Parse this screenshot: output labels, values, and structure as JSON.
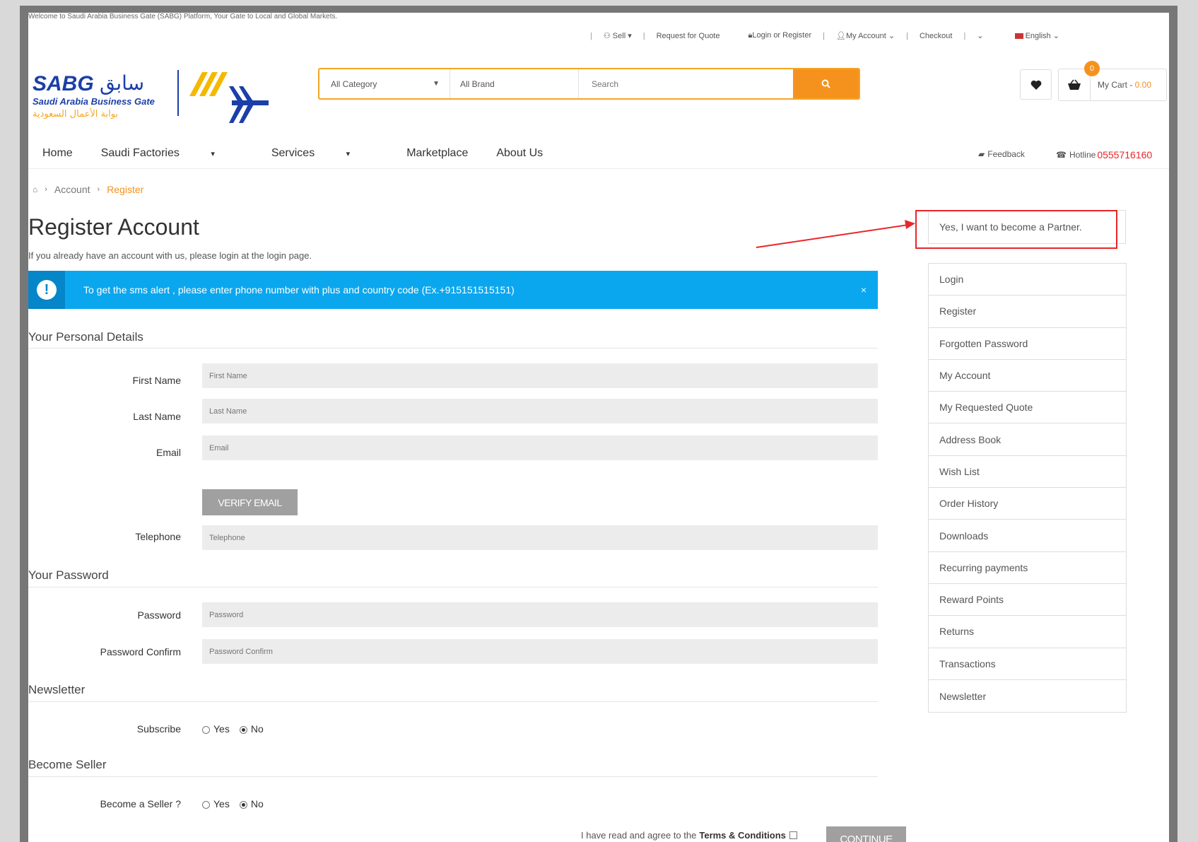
{
  "topbar": {
    "welcome": "Welcome to Saudi Arabia Business Gate (SABG) Platform, Your Gate to Local and Global Markets.",
    "sell": "Sell",
    "request_quote": "Request for Quote",
    "login_register": "Login or Register",
    "my_account": "My Account",
    "checkout": "Checkout",
    "language": "English"
  },
  "logo": {
    "brand": "SABG",
    "arabic_name": "سابق",
    "english_name": "Saudi Arabia Business Gate",
    "arabic_sub": "بوابة الأعمال السعودية"
  },
  "search": {
    "category": "All Category",
    "brand": "All Brand",
    "placeholder": "Search"
  },
  "cart": {
    "count": "0",
    "label": "My Cart - ",
    "amount": "0.00"
  },
  "nav": {
    "home": "Home",
    "factories": "Saudi Factories",
    "services": "Services",
    "marketplace": "Marketplace",
    "about": "About Us",
    "feedback": "Feedback",
    "hotline_label": "Hotline",
    "hotline_number": "0555716160"
  },
  "breadcrumb": {
    "account": "Account",
    "register": "Register"
  },
  "page": {
    "title": "Register Account",
    "intro": "If you already have an account with us, please login at the login page."
  },
  "alert": {
    "text": "To get the sms alert , please enter phone number with plus and country code (Ex.+915151515151)",
    "close": "×"
  },
  "form": {
    "personal_heading": "Your Personal Details",
    "first_name_label": "First Name",
    "first_name_placeholder": "First Name",
    "last_name_label": "Last Name",
    "last_name_placeholder": "Last Name",
    "email_label": "Email",
    "email_placeholder": "Email",
    "verify_email": "VERIFY EMAIL",
    "telephone_label": "Telephone",
    "telephone_placeholder": "Telephone",
    "password_heading": "Your Password",
    "password_label": "Password",
    "password_placeholder": "Password",
    "confirm_label": "Password Confirm",
    "confirm_placeholder": "Password Confirm",
    "newsletter_heading": "Newsletter",
    "subscribe_label": "Subscribe",
    "yes": "Yes",
    "no": "No",
    "seller_heading": "Become Seller",
    "seller_label": "Become a Seller ?",
    "agree_text": "I have read and agree to the",
    "terms": "Terms & Conditions",
    "continue": "CONTINUE"
  },
  "sidebar": {
    "partner": "Yes, I want to become a Partner.",
    "items": [
      "Login",
      "Register",
      "Forgotten Password",
      "My Account",
      "My Requested Quote",
      "Address Book",
      "Wish List",
      "Order History",
      "Downloads",
      "Recurring payments",
      "Reward Points",
      "Returns",
      "Transactions",
      "Newsletter"
    ]
  },
  "colors": {
    "accent": "#f5921e",
    "alert": "#0aa7ef",
    "annotation": "#e8262a"
  }
}
